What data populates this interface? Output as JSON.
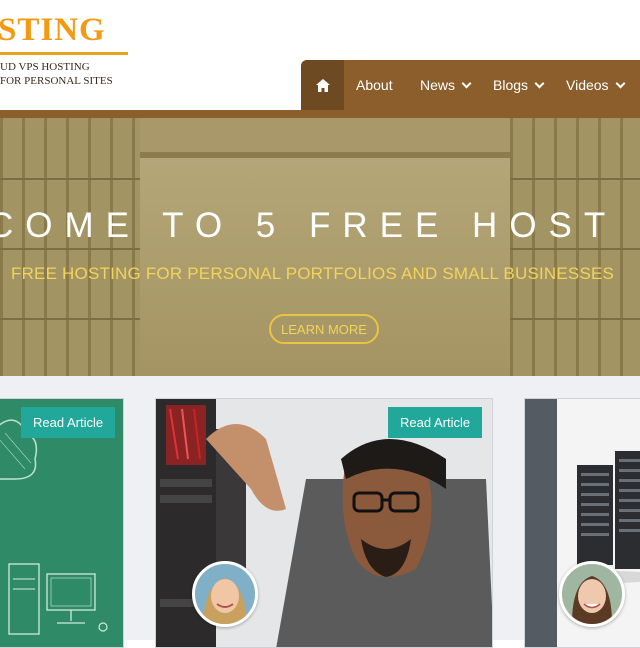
{
  "header": {
    "logo_text": "STING",
    "tagline_1": "UD VPS HOSTING",
    "tagline_2": "FOR PERSONAL SITES"
  },
  "nav": {
    "home_icon": "home-icon",
    "items": [
      {
        "label": "About",
        "dropdown": false
      },
      {
        "label": "News",
        "dropdown": true
      },
      {
        "label": "Blogs",
        "dropdown": true
      },
      {
        "label": "Videos",
        "dropdown": true
      }
    ]
  },
  "hero": {
    "title": "COME TO 5 FREE HOST",
    "subtitle": "FREE HOSTING FOR PERSONAL PORTFOLIOS AND SMALL BUSINESSES",
    "button_label": "LEARN MORE"
  },
  "cards": [
    {
      "button_label": "Read Article"
    },
    {
      "button_label": "Read Article"
    },
    {}
  ],
  "colors": {
    "brand_orange": "#f29a12",
    "nav_brown": "#8b5e2c",
    "nav_home_brown": "#6e4a22",
    "hero_tan": "#9b8a5a",
    "hero_accent_yellow": "#f2d45a",
    "teal_button": "#22a89a",
    "card_green": "#2f8a68"
  }
}
